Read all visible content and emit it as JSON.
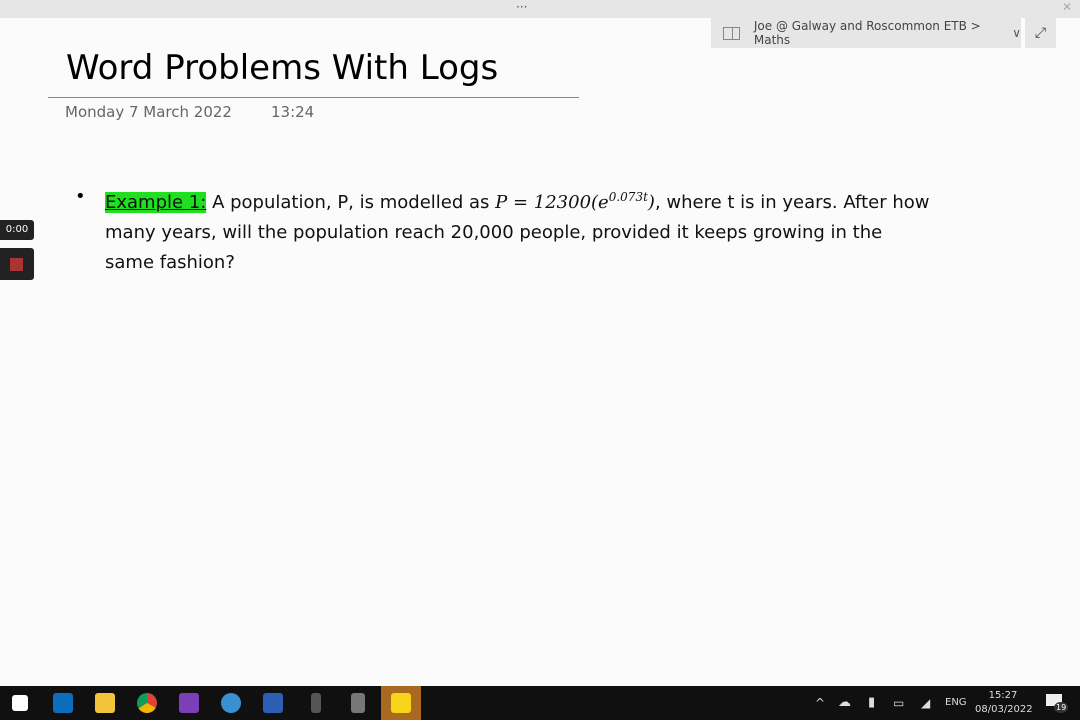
{
  "window": {
    "more_label": "···",
    "close_label": "✕"
  },
  "notebook": {
    "path": "Joe @ Galway and Roscommon ETB > Maths",
    "chevron": "∨",
    "expand_icon": "⤢"
  },
  "page": {
    "title": "Word Problems With Logs",
    "date": "Monday 7 March 2022",
    "time": "13:24"
  },
  "recorder": {
    "elapsed": "0:00"
  },
  "content": {
    "bullet": "•",
    "label": "Example 1:",
    "text1": " A population, P, is modelled as ",
    "math": "P = 12300(e",
    "exponent": "0.073t",
    "math_close": ")",
    "text2": ", where t is in years. After how many years, will the population reach 20,000 people, provided it keeps growing in the same fashion?",
    "highlight_color": "#1fe01f"
  },
  "taskbar": {
    "apps": [
      "windows-start",
      "outlook",
      "file-explorer",
      "chrome",
      "onenote",
      "remote-desktop",
      "word",
      "calculator-phone",
      "calculator",
      "sticky-notes"
    ],
    "lang": "ENG",
    "clock_time": "15:27",
    "clock_date": "08/03/2022",
    "notifications": "19"
  }
}
